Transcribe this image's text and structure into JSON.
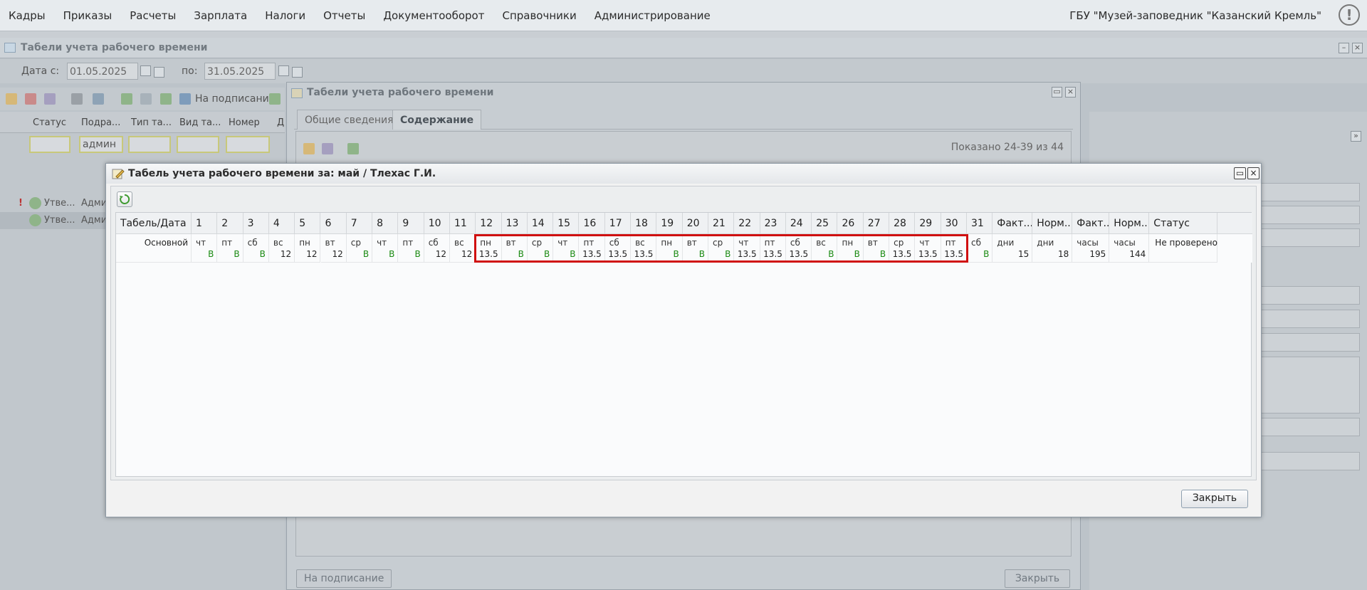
{
  "top_menu": {
    "items": [
      "Кадры",
      "Приказы",
      "Расчеты",
      "Зарплата",
      "Налоги",
      "Отчеты",
      "Документооборот",
      "Справочники",
      "Администрирование"
    ],
    "organization": "ГБУ \"Музей-заповедник \"Казанский Кремль\"",
    "alert_glyph": "!"
  },
  "bg_window": {
    "title": "Табели учета рабочего времени",
    "date_from_label": "Дата с:",
    "date_from": "01.05.2025",
    "date_to_label": "по:",
    "date_to": "31.05.2025",
    "sign_label": "На подписание",
    "columns": [
      "Статус",
      "Подра...",
      "Тип та...",
      "Вид та...",
      "Номер",
      "Д"
    ],
    "filter_dept": "админ",
    "rows": [
      {
        "status": "Утве...",
        "dept": "Адми",
        "flag": "!"
      },
      {
        "status": "Утве...",
        "dept": "Адми",
        "flag": ""
      }
    ]
  },
  "mid_window": {
    "title": "Табели учета рабочего времени",
    "tabs": [
      "Общие сведения",
      "Содержание"
    ],
    "active_tab": "Содержание",
    "shown": "Показано 24-39 из 44",
    "sign_label": "На подписание",
    "close_label": "Закрыть"
  },
  "modal": {
    "title": "Табель учета рабочего времени за: май / Тлехас Г.И.",
    "close_label": "Закрыть",
    "header_first": "Табель/Дата",
    "row_label": "Основной",
    "days": [
      {
        "n": "1",
        "wd": "чт",
        "v": "В"
      },
      {
        "n": "2",
        "wd": "пт",
        "v": "В"
      },
      {
        "n": "3",
        "wd": "сб",
        "v": "В"
      },
      {
        "n": "4",
        "wd": "вс",
        "v": "12"
      },
      {
        "n": "5",
        "wd": "пн",
        "v": "12"
      },
      {
        "n": "6",
        "wd": "вт",
        "v": "12"
      },
      {
        "n": "7",
        "wd": "ср",
        "v": "В"
      },
      {
        "n": "8",
        "wd": "чт",
        "v": "В"
      },
      {
        "n": "9",
        "wd": "пт",
        "v": "В"
      },
      {
        "n": "10",
        "wd": "сб",
        "v": "12"
      },
      {
        "n": "11",
        "wd": "вс",
        "v": "12"
      },
      {
        "n": "12",
        "wd": "пн",
        "v": "13.5"
      },
      {
        "n": "13",
        "wd": "вт",
        "v": "В"
      },
      {
        "n": "14",
        "wd": "ср",
        "v": "В"
      },
      {
        "n": "15",
        "wd": "чт",
        "v": "В"
      },
      {
        "n": "16",
        "wd": "пт",
        "v": "13.5"
      },
      {
        "n": "17",
        "wd": "сб",
        "v": "13.5"
      },
      {
        "n": "18",
        "wd": "вс",
        "v": "13.5"
      },
      {
        "n": "19",
        "wd": "пн",
        "v": "В"
      },
      {
        "n": "20",
        "wd": "вт",
        "v": "В"
      },
      {
        "n": "21",
        "wd": "ср",
        "v": "В"
      },
      {
        "n": "22",
        "wd": "чт",
        "v": "13.5"
      },
      {
        "n": "23",
        "wd": "пт",
        "v": "13.5"
      },
      {
        "n": "24",
        "wd": "сб",
        "v": "13.5"
      },
      {
        "n": "25",
        "wd": "вс",
        "v": "В"
      },
      {
        "n": "26",
        "wd": "пн",
        "v": "В"
      },
      {
        "n": "27",
        "wd": "вт",
        "v": "В"
      },
      {
        "n": "28",
        "wd": "ср",
        "v": "13.5"
      },
      {
        "n": "29",
        "wd": "чт",
        "v": "13.5"
      },
      {
        "n": "30",
        "wd": "пт",
        "v": "13.5"
      },
      {
        "n": "31",
        "wd": "сб",
        "v": "В"
      }
    ],
    "summary_cols": [
      {
        "h": "Факт...",
        "unit": "дни",
        "v": "15"
      },
      {
        "h": "Норм...",
        "unit": "дни",
        "v": "18"
      },
      {
        "h": "Факт...",
        "unit": "часы",
        "v": "195"
      },
      {
        "h": "Норм...",
        "unit": "часы",
        "v": "144"
      }
    ],
    "status_header": "Статус",
    "status_value": "Не проверено",
    "highlight_from_day": 12,
    "highlight_to_day": 30
  },
  "colors": {
    "weekend_mark": "#1a8a12",
    "highlight": "#d01010"
  }
}
